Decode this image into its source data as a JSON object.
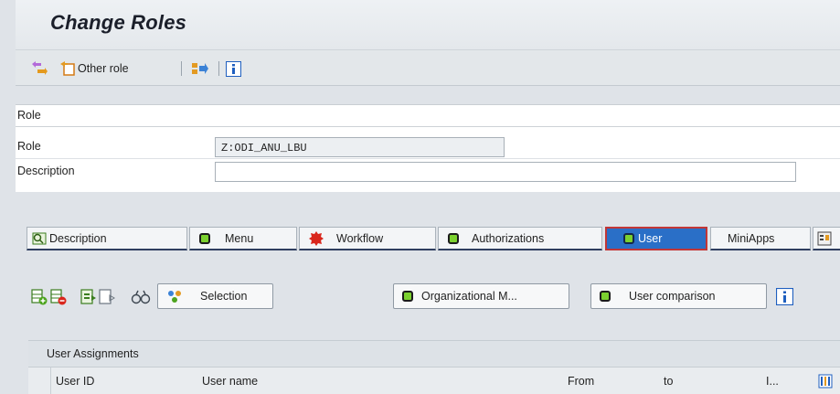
{
  "title": "Change Roles",
  "toolbar": {
    "other_role_label": "Other role",
    "icons": [
      "display-change-icon",
      "other-role-icon",
      "transport-icon",
      "info-icon"
    ]
  },
  "role_panel": {
    "header": "Role",
    "role_label": "Role",
    "role_value": "Z:ODI_ANU_LBU",
    "description_label": "Description",
    "description_value": ""
  },
  "tabs": [
    {
      "label": "Description",
      "icon": "description-icon"
    },
    {
      "label": "Menu",
      "status": "green"
    },
    {
      "label": "Workflow",
      "status": "red"
    },
    {
      "label": "Authorizations",
      "status": "green"
    },
    {
      "label": "User",
      "status": "green",
      "active": true
    },
    {
      "label": "MiniApps"
    }
  ],
  "actions": {
    "selection_label": "Selection",
    "org_mgmt_label": "Organizational M...",
    "user_comparison_label": "User comparison"
  },
  "grid": {
    "title": "User Assignments",
    "columns": [
      "User ID",
      "User name",
      "From",
      "to",
      "I..."
    ]
  },
  "colors": {
    "status_green": "#7bd12f",
    "status_red": "#d9261c",
    "active_tab": "#2a6fc7",
    "info_blue": "#1f5fbf"
  }
}
